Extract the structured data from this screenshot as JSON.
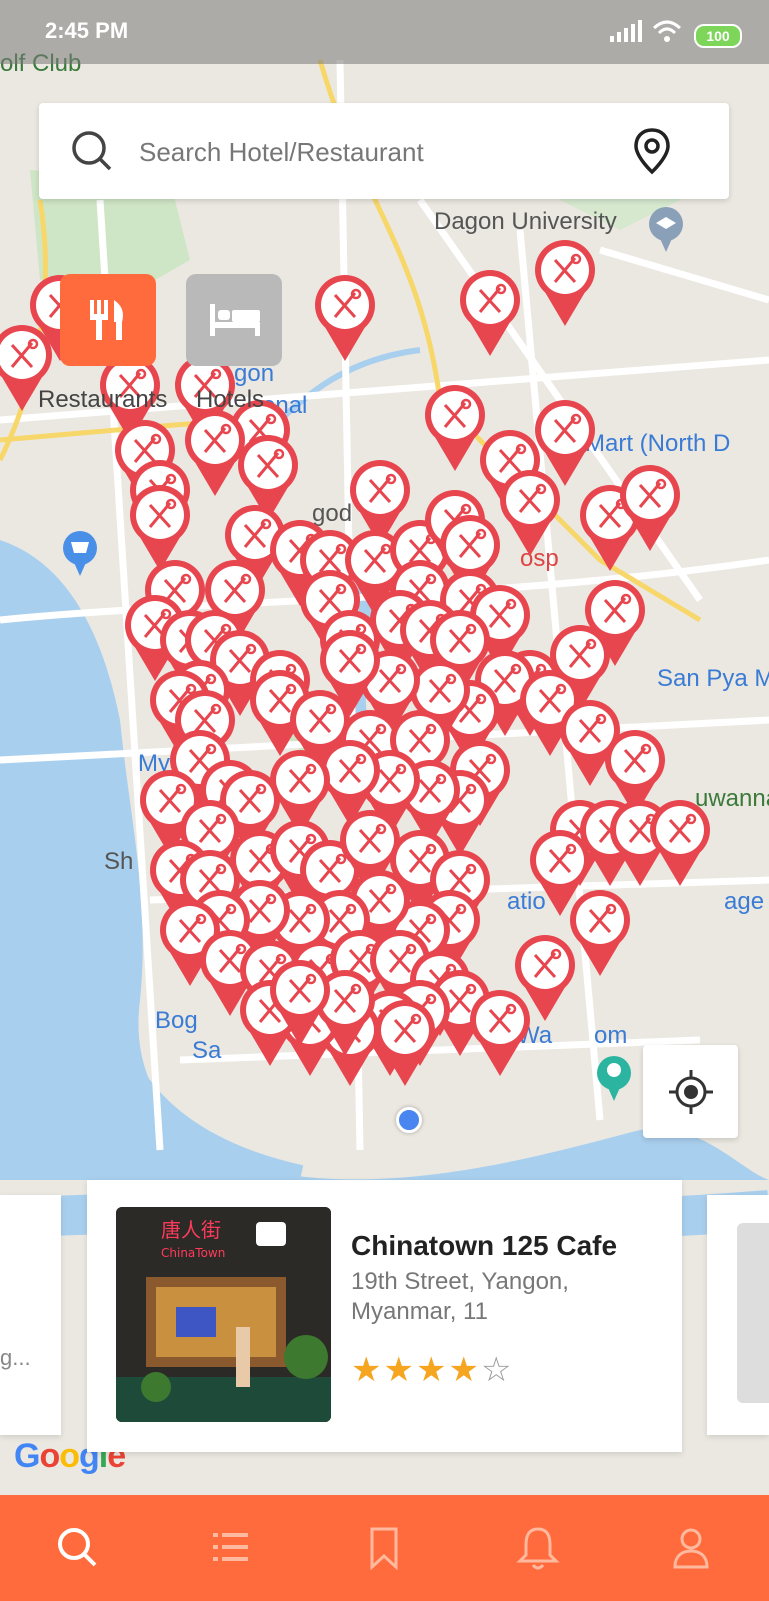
{
  "status_bar": {
    "time": "2:45 PM",
    "battery": "100"
  },
  "search": {
    "placeholder": "Search Hotel/Restaurant"
  },
  "map": {
    "labels": [
      {
        "text": "olf Club"
      },
      {
        "text": "Dagon University"
      },
      {
        "text": "Mart (North D"
      },
      {
        "text": "San Pya M"
      },
      {
        "text": "uwanna"
      },
      {
        "text": "age"
      },
      {
        "text": "Sh"
      },
      {
        "text": "Bog"
      },
      {
        "text": "Sa"
      },
      {
        "text": "My"
      },
      {
        "text": "gon"
      },
      {
        "text": "onal"
      },
      {
        "text": "god"
      },
      {
        "text": "Wa"
      },
      {
        "text": "om"
      },
      {
        "text": "atio"
      },
      {
        "text": "osp"
      }
    ],
    "google_logo": "Google"
  },
  "categories": [
    {
      "label": "Restaurants",
      "active": true
    },
    {
      "label": "Hotels",
      "active": false
    }
  ],
  "cards": {
    "main": {
      "name": "Chinatown 125 Cafe",
      "address_line1": "19th Street, Yangon,",
      "address_line2": "Myanmar, 11",
      "rating": 4,
      "rating_max": 5
    },
    "left_peek_text": "g..."
  },
  "nav": [
    {
      "name": "search",
      "active": true
    },
    {
      "name": "list",
      "active": false
    },
    {
      "name": "bookmark",
      "active": false
    },
    {
      "name": "notifications",
      "active": false
    },
    {
      "name": "profile",
      "active": false
    }
  ],
  "colors": {
    "accent": "#ff6b3d",
    "pin": "#e8464f",
    "star": "#f5a51f",
    "hotel_btn": "#b9b9b9"
  }
}
